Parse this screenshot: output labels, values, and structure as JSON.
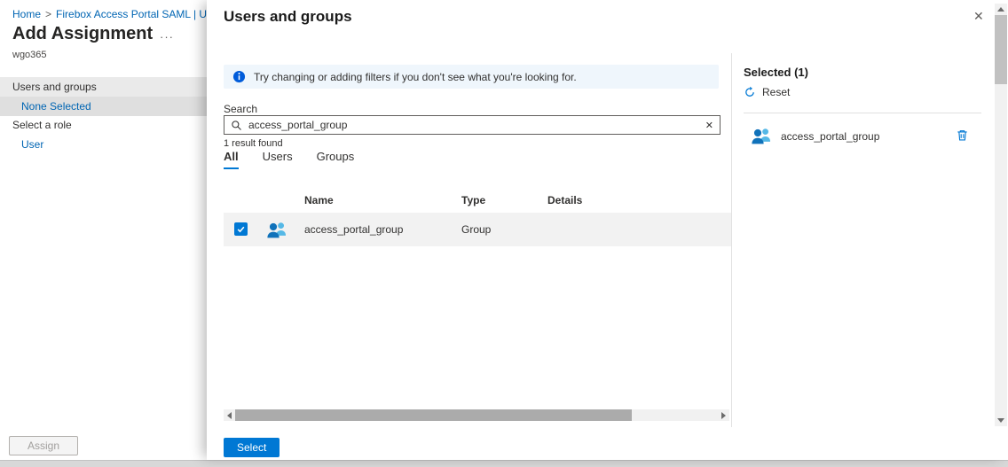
{
  "colors": {
    "accent": "#0078d4",
    "link": "#0065b3",
    "info_banner_bg": "#eff6fc",
    "selected_row_bg": "#f2f2f2",
    "group_icon_front": "#1072ba",
    "group_icon_back": "#55b8e6"
  },
  "background_page": {
    "breadcrumb": {
      "home": "Home",
      "separator": ">",
      "current": "Firebox Access Portal SAML | Users"
    },
    "title": "Add Assignment",
    "more_menu": "···",
    "subtitle": "wgo365",
    "users_groups_label": "Users and groups",
    "none_selected_link": "None Selected",
    "select_role_label": "Select a role",
    "user_link": "User",
    "assign_button": "Assign"
  },
  "panel": {
    "title": "Users and groups",
    "close_icon": "✕",
    "info_message": "Try changing or adding filters if you don't see what you're looking for.",
    "search": {
      "label": "Search",
      "value": "access_portal_group",
      "clear_icon": "✕",
      "results": "1 result found"
    },
    "tabs": [
      {
        "label": "All"
      },
      {
        "label": "Users"
      },
      {
        "label": "Groups"
      }
    ],
    "table": {
      "columns": [
        "Name",
        "Type",
        "Details"
      ],
      "rows": [
        {
          "name": "access_portal_group",
          "type": "Group",
          "details": "",
          "checked": true
        }
      ]
    },
    "footer": {
      "select_button": "Select"
    }
  },
  "selected_panel": {
    "title": "Selected (1)",
    "reset_label": "Reset",
    "items": [
      {
        "name": "access_portal_group"
      }
    ]
  }
}
